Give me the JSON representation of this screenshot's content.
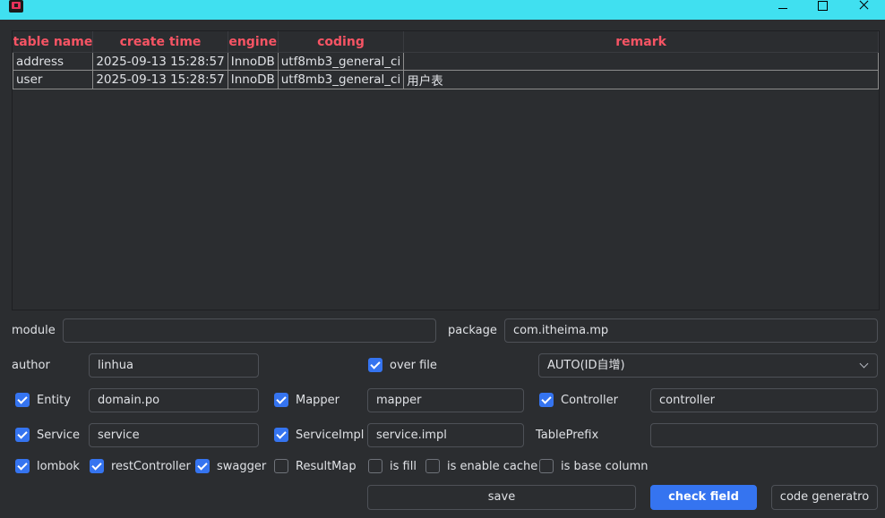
{
  "window": {
    "icon": "intellij-app-icon",
    "controls": [
      "minimize-icon",
      "maximize-icon",
      "close-icon"
    ]
  },
  "table": {
    "columns": [
      "table name",
      "create time",
      "engine",
      "coding",
      "remark"
    ],
    "rows": [
      [
        "address",
        "2025-09-13 15:28:57",
        "InnoDB",
        "utf8mb3_general_ci",
        ""
      ],
      [
        "user",
        "2025-09-13 15:28:57",
        "InnoDB",
        "utf8mb3_general_ci",
        "用户表"
      ]
    ]
  },
  "form": {
    "module_label": "module",
    "module_value": "",
    "package_label": "package",
    "package_value": "com.itheima.mp",
    "author_label": "author",
    "author_value": "linhua",
    "over_file_label": "over file",
    "id_type_value": "AUTO(ID自增)",
    "entity_label": "Entity",
    "entity_value": "domain.po",
    "mapper_label": "Mapper",
    "mapper_value": "mapper",
    "controller_label": "Controller",
    "controller_value": "controller",
    "service_label": "Service",
    "service_value": "service",
    "serviceimpl_label": "ServiceImpl",
    "serviceimpl_value": "service.impl",
    "tableprefix_label": "TablePrefix",
    "tableprefix_value": "",
    "lombok_label": "lombok",
    "restcontroller_label": "restController",
    "swagger_label": "swagger",
    "resultmap_label": "ResultMap",
    "isfill_label": "is fill",
    "enablecache_label": "is enable cache",
    "basecolumn_label": "is base column"
  },
  "checks": {
    "over_file": true,
    "entity": true,
    "mapper": true,
    "controller": true,
    "service": true,
    "serviceimpl": true,
    "lombok": true,
    "restcontroller": true,
    "swagger": true,
    "resultmap": false,
    "isfill": false,
    "enablecache": false,
    "basecolumn": false
  },
  "buttons": {
    "save": "save",
    "check_field": "check field",
    "code_generator": "code generatro"
  },
  "colors": {
    "titlebar": "#40e0f0",
    "header_text": "#f75464",
    "accent": "#3574f0",
    "background": "#2b2d30"
  }
}
